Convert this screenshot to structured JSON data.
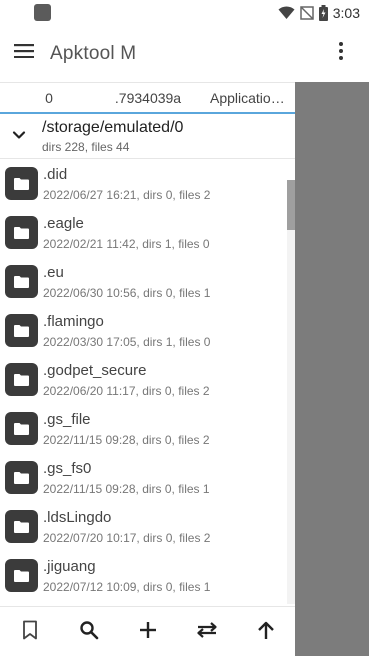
{
  "status_bar": {
    "time": "3:03"
  },
  "app_bar": {
    "title": "Apktool M"
  },
  "tabs": [
    {
      "label": "0"
    },
    {
      "label": ".7934039a"
    },
    {
      "label": "Applicatio…"
    }
  ],
  "path": {
    "title": "/storage/emulated/0",
    "summary": "dirs 228, files 44"
  },
  "files": [
    {
      "name": ".did",
      "meta": "2022/06/27 16:21, dirs 0, files 2"
    },
    {
      "name": ".eagle",
      "meta": "2022/02/21 11:42, dirs 1, files 0"
    },
    {
      "name": ".eu",
      "meta": "2022/06/30 10:56, dirs 0, files 1"
    },
    {
      "name": ".flamingo",
      "meta": "2022/03/30 17:05, dirs 1, files 0"
    },
    {
      "name": ".godpet_secure",
      "meta": "2022/06/20 11:17, dirs 0, files 2"
    },
    {
      "name": ".gs_file",
      "meta": "2022/11/15 09:28, dirs 0, files 2"
    },
    {
      "name": ".gs_fs0",
      "meta": "2022/11/15 09:28, dirs 0, files 1"
    },
    {
      "name": ".ldsLingdo",
      "meta": "2022/07/20 10:17, dirs 0, files 2"
    },
    {
      "name": ".jiguang",
      "meta": "2022/07/12 10:09, dirs 0, files 1"
    }
  ],
  "bottom_actions": [
    {
      "icon": "bookmark-icon"
    },
    {
      "icon": "search-icon"
    },
    {
      "icon": "add-icon"
    },
    {
      "icon": "swap-icon"
    },
    {
      "icon": "arrow-up-icon"
    }
  ],
  "colors": {
    "accent": "#5aa6dc",
    "scrim": "#7c7c7c",
    "folder_tile": "#3b3b3b"
  }
}
